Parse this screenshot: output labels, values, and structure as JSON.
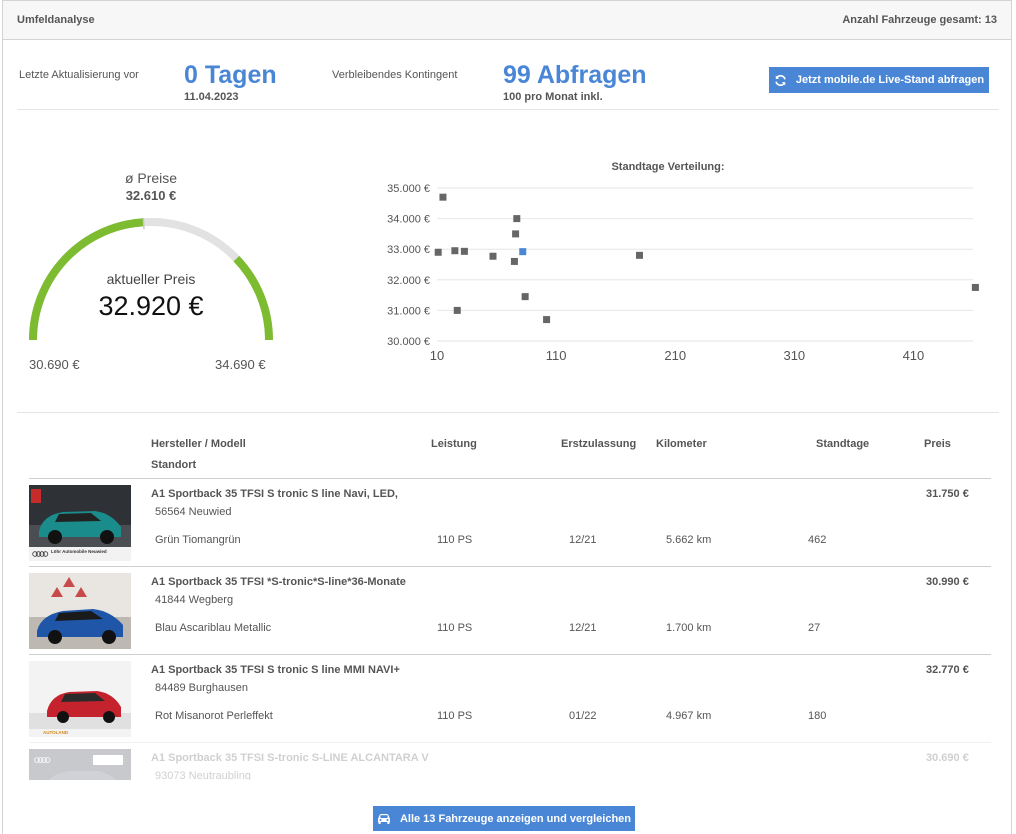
{
  "header": {
    "title": "Umfeldanalyse",
    "count_text": "Anzahl Fahrzeuge gesamt: 13"
  },
  "stats": {
    "last_update_label": "Letzte Aktualisierung vor",
    "last_update_value": "0 Tagen",
    "last_update_date": "11.04.2023",
    "quota_label": "Verbleibendes Kontingent",
    "quota_value": "99 Abfragen",
    "quota_note": "100 pro Monat inkl.",
    "live_button": "Jetzt mobile.de Live-Stand abfragen",
    "live_button_icon": "refresh-icon"
  },
  "gauge": {
    "avg_label": "ø Preise",
    "avg_value": "32.610 €",
    "current_label": "aktueller Preis",
    "current_value": "32.920 €",
    "min_label": "30.690 €",
    "max_label": "34.690 €",
    "min": 30690,
    "max": 34690,
    "avg": 32610,
    "current": 32920,
    "fill_color": "#7dbb31",
    "track_color": "#e2e2e2"
  },
  "chart_data": {
    "type": "scatter",
    "title": "Standtage Verteilung:",
    "xlabel": "",
    "ylabel": "",
    "xlim": [
      10,
      460
    ],
    "ylim": [
      30000,
      35000
    ],
    "x_ticks": [
      "10",
      "110",
      "210",
      "310",
      "410"
    ],
    "x_tick_values": [
      10,
      110,
      210,
      310,
      410
    ],
    "y_ticks": [
      "35.000 €",
      "34.000 €",
      "33.000 €",
      "32.000 €",
      "31.000 €",
      "30.000 €"
    ],
    "y_tick_values": [
      35000,
      34000,
      33000,
      32000,
      31000,
      30000
    ],
    "grid": true,
    "series": [
      {
        "color": "#666666",
        "points": [
          {
            "x": 11,
            "y": 32900
          },
          {
            "x": 15,
            "y": 34700
          },
          {
            "x": 25,
            "y": 32950
          },
          {
            "x": 27,
            "y": 31000
          },
          {
            "x": 33,
            "y": 32930
          },
          {
            "x": 57,
            "y": 32770
          },
          {
            "x": 75,
            "y": 32600
          },
          {
            "x": 76,
            "y": 33500
          },
          {
            "x": 77,
            "y": 34000
          },
          {
            "x": 84,
            "y": 31450
          },
          {
            "x": 102,
            "y": 30700
          },
          {
            "x": 180,
            "y": 32800
          },
          {
            "x": 462,
            "y": 31750
          }
        ]
      },
      {
        "color": "#4a86d6",
        "points": [
          {
            "x": 82,
            "y": 32920
          }
        ]
      }
    ]
  },
  "table": {
    "headers": {
      "model": "Hersteller / Modell",
      "location": "Standort",
      "power": "Leistung",
      "registration": "Erstzulassung",
      "mileage": "Kilometer",
      "days": "Standtage",
      "price": "Preis"
    },
    "rows": [
      {
        "title": "A1 Sportback 35 TFSI S tronic S line Navi, LED,",
        "location": "56564 Neuwied",
        "color": "Grün Tiomangrün",
        "power": "110 PS",
        "registration": "12/21",
        "mileage": "5.662 km",
        "days": "462",
        "price": "31.750 €",
        "dealer": "Löhr Automobile Neuwied"
      },
      {
        "title": "A1 Sportback 35 TFSI *S-tronic*S-line*36-Monate",
        "location": "41844 Wegberg",
        "color": "Blau Ascariblau Metallic",
        "power": "110 PS",
        "registration": "12/21",
        "mileage": "1.700 km",
        "days": "27",
        "price": "30.990 €",
        "dealer": ""
      },
      {
        "title": "A1 Sportback 35 TFSI S tronic S line MMI NAVI+",
        "location": "84489 Burghausen",
        "color": "Rot Misanorot Perleffekt",
        "power": "110 PS",
        "registration": "01/22",
        "mileage": "4.967 km",
        "days": "180",
        "price": "32.770 €",
        "dealer": "AUTOLAND"
      },
      {
        "title": "A1 Sportback 35 TFSI S-tronic S-LINE ALCANTARA V",
        "location": "93073 Neutraubling",
        "color": "",
        "power": "",
        "registration": "",
        "mileage": "",
        "days": "",
        "price": "30.690 €",
        "dealer": ""
      }
    ]
  },
  "footer": {
    "button_label": "Alle 13 Fahrzeuge anzeigen und vergleichen",
    "button_icon": "car-icon"
  }
}
